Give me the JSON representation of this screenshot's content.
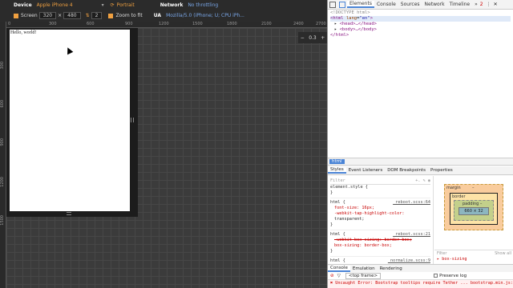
{
  "emulation": {
    "device_label": "Device",
    "device_value": "Apple iPhone 4",
    "orientation_label": "Portrait",
    "network_label": "Network",
    "network_value": "No throttling",
    "screen_label": "Screen",
    "screen_width": "320",
    "screen_x": "×",
    "screen_height": "480",
    "dpr_value": "2",
    "zoom_to_fit_label": "Zoom to fit",
    "ua_label": "UA",
    "ua_value": "Mozilla/5.0 (iPhone; U; CPU iPh...",
    "ruler_top": [
      "0",
      "300",
      "600",
      "900",
      "1200",
      "1500",
      "1800",
      "2100",
      "2400",
      "2700"
    ],
    "ruler_left": [
      "300",
      "600",
      "900",
      "1200",
      "1500"
    ]
  },
  "viewport": {
    "page_text": "Hello, world!"
  },
  "zoom": {
    "minus": "−",
    "value": "0.3",
    "plus": "+"
  },
  "devtools": {
    "tabs": [
      "Elements",
      "Console",
      "Sources",
      "Network",
      "Timeline",
      "»"
    ],
    "badge": "2",
    "dom": {
      "doctype": "<!DOCTYPE html>",
      "html_open_tag": "html",
      "html_attr": "lang",
      "html_attr_value": "\"en\"",
      "head": "<head>…</head>",
      "body": "<body>…</body>",
      "html_close": "</html>"
    },
    "breadcrumb": "html",
    "sub_tabs": [
      "Styles",
      "Event Listeners",
      "DOM Breakpoints",
      "Properties"
    ],
    "filter_placeholder": "Filter",
    "styles": {
      "element_style": "element.style {",
      "close": "}",
      "rule1_selector": "html {",
      "rule1_source": "_reboot.scss:64",
      "rule1_props": [
        "font-size: 16px;",
        "-webkit-tap-highlight-color:",
        "    transparent;"
      ],
      "rule2_selector": "html {",
      "rule2_source": "_reboot.scss:21",
      "rule2_props": [
        "-webkit-box-sizing: border-box;",
        "box-sizing: border-box;"
      ],
      "rule3_selector": "html {",
      "rule3_source": "_normalize.scss:9"
    },
    "box_model": {
      "margin_label": "margin",
      "border_label": "border",
      "padding_label": "padding –",
      "content": "660 × 32",
      "dash": "–",
      "filter": "Filter",
      "show_all": "Show all",
      "computed_prop": "▸ box-sizing"
    },
    "drawer_tabs": [
      "Console",
      "Emulation",
      "Rendering"
    ],
    "console": {
      "frame": "<top frame>",
      "preserve_log": "Preserve log",
      "error": "✖ Uncaught Error: Bootstrap tooltips require Tether ... bootstrap.min.js:7"
    }
  }
}
